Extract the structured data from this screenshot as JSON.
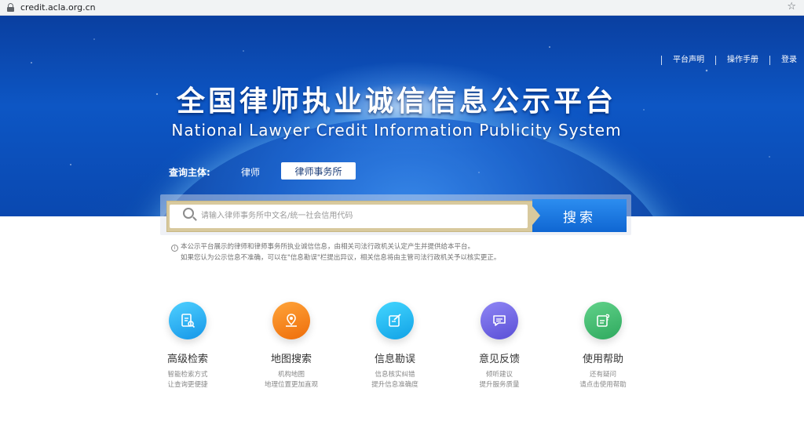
{
  "browser": {
    "url": "credit.acla.org.cn",
    "bookmark_icon": "star-icon"
  },
  "nav": {
    "items": [
      "平台声明",
      "操作手册",
      "登录"
    ]
  },
  "hero": {
    "title_cn": "全国律师执业诚信信息公示平台",
    "title_en": "National Lawyer Credit Information Publicity System"
  },
  "query": {
    "label": "查询主体:",
    "options": [
      "律师",
      "律师事务所"
    ],
    "selected": "律师事务所"
  },
  "search": {
    "placeholder": "请输入律师事务所中文名/统一社会信用代码",
    "value": "",
    "button": "搜索"
  },
  "notice": {
    "line1": "本公示平台展示的律师和律师事务所执业诚信信息，由相关司法行政机关认定产生并提供给本平台。",
    "line2": "如果您认为公示信息不准确，可以在\"信息勘误\"栏提出异议，相关信息将由主管司法行政机关予以核实更正。"
  },
  "features": [
    {
      "name": "高级检索",
      "desc1": "智能检索方式",
      "desc2": "让查询更便捷",
      "icon": "document-search-icon",
      "color": "#1fa8ee"
    },
    {
      "name": "地图搜索",
      "desc1": "机构地图",
      "desc2": "地理位置更加直观",
      "icon": "map-pin-icon",
      "color": "#f07a10"
    },
    {
      "name": "信息勘误",
      "desc1": "信息核实纠错",
      "desc2": "提升信息准确度",
      "icon": "edit-icon",
      "color": "#18b4ec"
    },
    {
      "name": "意见反馈",
      "desc1": "倾听建议",
      "desc2": "提升服务质量",
      "icon": "chat-icon",
      "color": "#6b62e0"
    },
    {
      "name": "使用帮助",
      "desc1": "还有疑问",
      "desc2": "请点击使用帮助",
      "icon": "help-icon",
      "color": "#3ab66b"
    }
  ]
}
